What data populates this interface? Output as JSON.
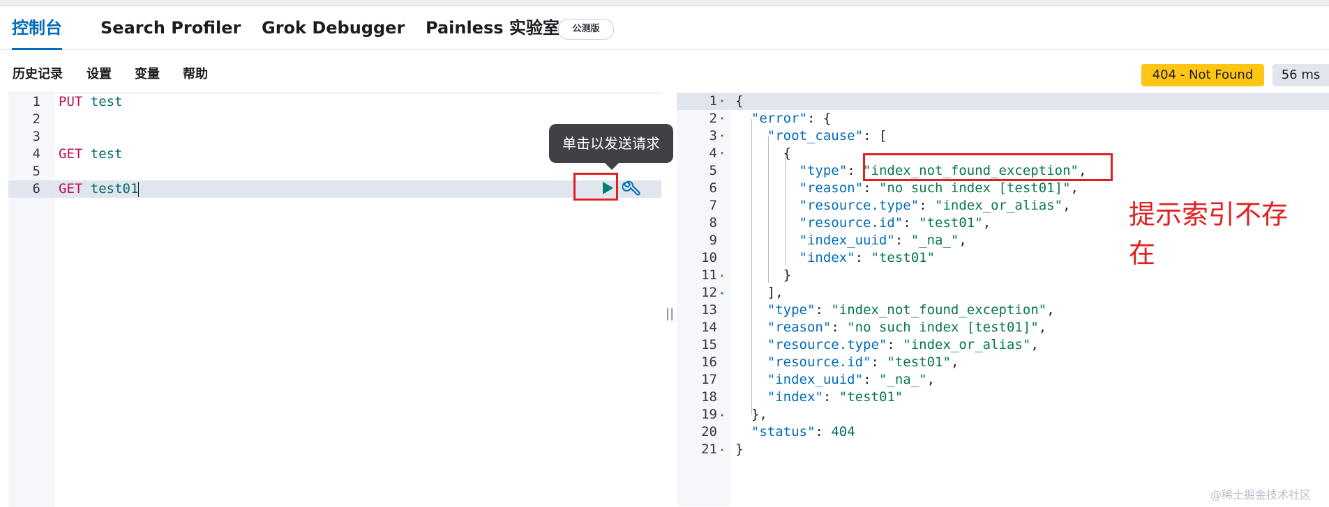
{
  "tabs": [
    {
      "label": "控制台",
      "active": true
    },
    {
      "label": "Search Profiler"
    },
    {
      "label": "Grok Debugger"
    },
    {
      "label": "Painless 实验室"
    }
  ],
  "beta_badge": "公测版",
  "menu": {
    "history": "历史记录",
    "settings": "设置",
    "variables": "变量",
    "help": "帮助"
  },
  "status": {
    "code_text": "404 - Not Found",
    "time": "56 ms",
    "color": "#fec514"
  },
  "editor": {
    "lines": [
      {
        "num": "1",
        "method": "PUT",
        "path": "test"
      },
      {
        "num": "2",
        "method": "",
        "path": ""
      },
      {
        "num": "3",
        "method": "",
        "path": ""
      },
      {
        "num": "4",
        "method": "GET",
        "path": "test"
      },
      {
        "num": "5",
        "method": "",
        "path": ""
      },
      {
        "num": "6",
        "method": "GET",
        "path": "test01"
      }
    ],
    "tooltip": "单击以发送请求"
  },
  "output": {
    "line_numbers": [
      "1",
      "2",
      "3",
      "4",
      "5",
      "6",
      "7",
      "8",
      "9",
      "10",
      "11",
      "12",
      "13",
      "14",
      "15",
      "16",
      "17",
      "18",
      "19",
      "20",
      "21"
    ],
    "error_key": "error",
    "root_cause_key": "root_cause",
    "rc_type_key": "type",
    "rc_type_val": "index_not_found_exception",
    "rc_reason_key": "reason",
    "rc_reason_val": "no such index [test01]",
    "rc_rtype_key": "resource.type",
    "rc_rtype_val": "index_or_alias",
    "rc_rid_key": "resource.id",
    "rc_rid_val": "test01",
    "rc_uuid_key": "index_uuid",
    "rc_uuid_val": "_na_",
    "rc_index_key": "index",
    "rc_index_val": "test01",
    "type_key": "type",
    "type_val": "index_not_found_exception",
    "reason_key": "reason",
    "reason_val": "no such index [test01]",
    "rtype_key": "resource.type",
    "rtype_val": "index_or_alias",
    "rid_key": "resource.id",
    "rid_val": "test01",
    "uuid_key": "index_uuid",
    "uuid_val": "_na_",
    "index_key": "index",
    "index_val": "test01",
    "status_key": "status",
    "status_val": "404"
  },
  "annotation": "提示索引不存在",
  "watermark": "@稀土掘金技术社区",
  "colors": {
    "accent": "#006bb8",
    "annotation": "#e02020",
    "warning": "#fec514"
  }
}
